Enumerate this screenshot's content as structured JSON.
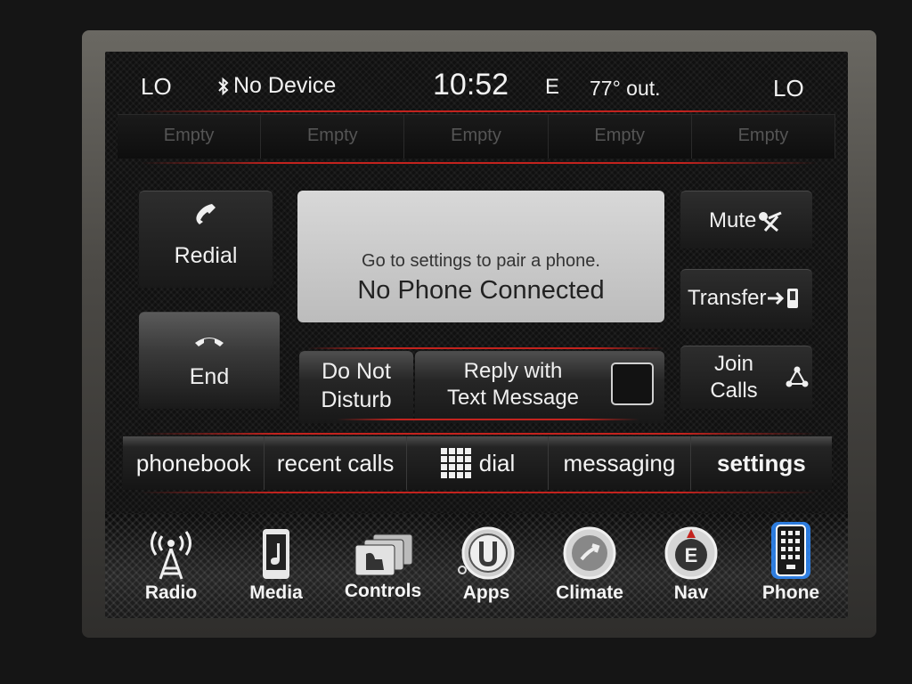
{
  "status": {
    "temp_left": "LO",
    "bluetooth": "No Device",
    "time": "10:52",
    "compass": "E",
    "outside_temp": "77° out.",
    "temp_right": "LO"
  },
  "presets": [
    "Empty",
    "Empty",
    "Empty",
    "Empty",
    "Empty"
  ],
  "buttons": {
    "redial": "Redial",
    "end": "End",
    "mute": "Mute",
    "transfer": "Transfer",
    "dnd_line1": "Do Not",
    "dnd_line2": "Disturb",
    "reply_line1": "Reply with",
    "reply_line2": "Text Message",
    "join_line1": "Join",
    "join_line2": "Calls"
  },
  "info": {
    "hint": "Go to settings to pair a phone.",
    "status": "No Phone Connected"
  },
  "tabs": {
    "phonebook": "phonebook",
    "recent_calls": "recent calls",
    "dial": "dial",
    "messaging": "messaging",
    "settings": "settings"
  },
  "dock": {
    "radio": "Radio",
    "media": "Media",
    "controls": "Controls",
    "apps": "Apps",
    "climate": "Climate",
    "nav": "Nav",
    "phone": "Phone"
  },
  "colors": {
    "accent_red": "#c3231e",
    "active_blue": "#2f8cff"
  },
  "icons": [
    "bluetooth-icon",
    "phone-handset-icon",
    "hang-up-icon",
    "mute-icon",
    "transfer-icon",
    "join-calls-icon",
    "keypad-icon",
    "radio-tower-icon",
    "media-icon",
    "controls-icon",
    "apps-icon",
    "climate-icon",
    "nav-compass-icon",
    "phone-icon"
  ]
}
